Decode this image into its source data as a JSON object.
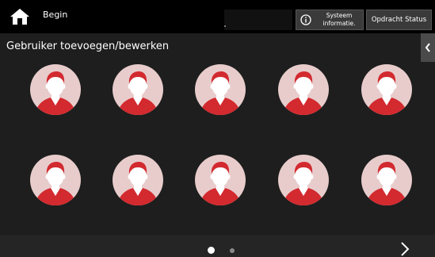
{
  "header": {
    "home_label": "Begin",
    "sysinfo_label": "Systeem\ninformatie.",
    "job_status_label": "Opdracht Status"
  },
  "main": {
    "title": "Gebruiker toevoegen/bewerken",
    "users": [
      {
        "icon": "user-avatar-icon"
      },
      {
        "icon": "user-avatar-icon"
      },
      {
        "icon": "user-avatar-icon"
      },
      {
        "icon": "user-avatar-icon"
      },
      {
        "icon": "user-avatar-icon"
      },
      {
        "icon": "user-avatar-icon"
      },
      {
        "icon": "user-avatar-icon"
      },
      {
        "icon": "user-avatar-icon"
      },
      {
        "icon": "user-avatar-icon"
      },
      {
        "icon": "user-avatar-icon"
      }
    ]
  },
  "pagination": {
    "current_page": 1,
    "total_pages": 2
  },
  "colors": {
    "avatar_bg": "#e8cccc",
    "avatar_red": "#d22a2f",
    "screen_bg": "#1e1e1e",
    "topbar_bg": "#000000"
  }
}
